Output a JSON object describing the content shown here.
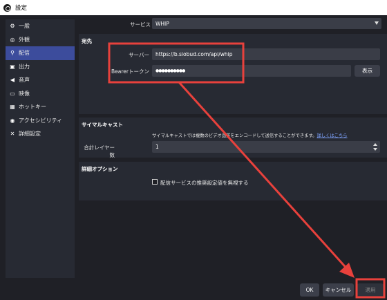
{
  "window": {
    "title": "設定"
  },
  "sidebar": {
    "items": [
      {
        "label": "一般",
        "icon": "gear-icon",
        "glyph": "⚙",
        "selected": false
      },
      {
        "label": "外観",
        "icon": "palette-icon",
        "glyph": "◎",
        "selected": false
      },
      {
        "label": "配信",
        "icon": "antenna-icon",
        "glyph": "⚲",
        "selected": true
      },
      {
        "label": "出力",
        "icon": "output-icon",
        "glyph": "▣",
        "selected": false
      },
      {
        "label": "音声",
        "icon": "speaker-icon",
        "glyph": "◀",
        "selected": false
      },
      {
        "label": "映像",
        "icon": "monitor-icon",
        "glyph": "▭",
        "selected": false
      },
      {
        "label": "ホットキー",
        "icon": "keyboard-icon",
        "glyph": "▦",
        "selected": false
      },
      {
        "label": "アクセシビリティ",
        "icon": "accessibility-icon",
        "glyph": "◉",
        "selected": false
      },
      {
        "label": "詳細設定",
        "icon": "tools-icon",
        "glyph": "✕",
        "selected": false
      }
    ]
  },
  "service": {
    "label": "サービス",
    "value": "WHIP"
  },
  "destination": {
    "title": "宛先",
    "server_label": "サーバー",
    "server_value": "https://b.siobud.com/api/whip",
    "token_label": "Bearerトークン",
    "token_value": "●●●●●●●●●●",
    "show_button": "表示"
  },
  "simulcast": {
    "title": "サイマルキャスト",
    "description": "サイマルキャストでは複数のビデオ品質をエンコードして送信することができます。",
    "link": "詳しくはこちら",
    "layers_label": "合計レイヤー数",
    "layers_value": "1"
  },
  "advanced": {
    "title": "詳細オプション",
    "ignore_checkbox_label": "配信サービスの推奨設定値を無視する",
    "ignore_checked": false
  },
  "footer": {
    "ok": "OK",
    "cancel": "キャンセル",
    "apply": "適用"
  },
  "annotation": {
    "color": "#e8413c"
  }
}
